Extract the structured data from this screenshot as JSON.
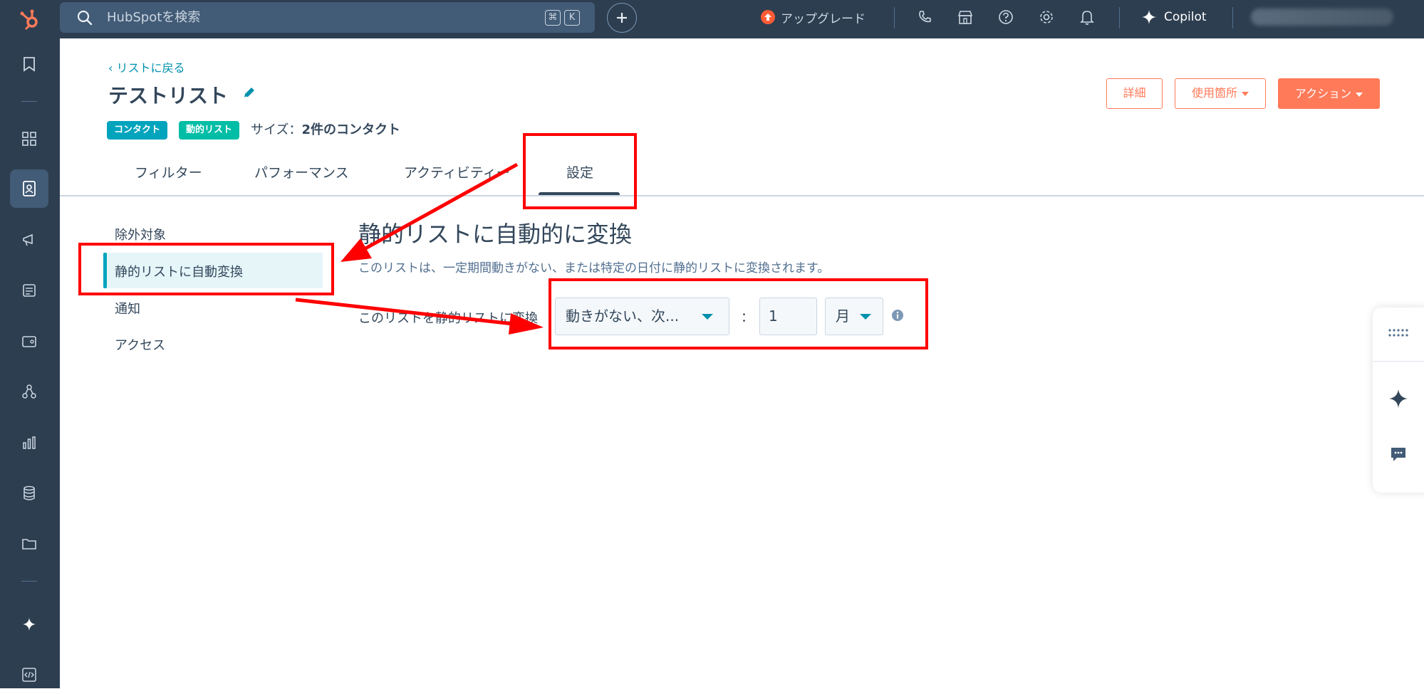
{
  "topbar": {
    "search_placeholder": "HubSpotを検索",
    "shortcut_keys": [
      "⌘",
      "K"
    ],
    "upgrade_label": "アップグレード",
    "copilot_label": "Copilot",
    "icons": [
      "phone-icon",
      "marketplace-icon",
      "help-icon",
      "settings-icon",
      "notifications-icon"
    ]
  },
  "sidebar": {
    "icons": [
      "bookmark-icon",
      "dashboard-icon",
      "contacts-icon",
      "marketing-icon",
      "content-icon",
      "commerce-icon",
      "automation-icon",
      "reporting-icon",
      "data-icon",
      "library-icon",
      "ai-icon",
      "developer-icon"
    ],
    "active": "contacts-icon"
  },
  "header": {
    "back_link": "リストに戻る",
    "title": "テストリスト",
    "badge_contact": "コンタクト",
    "badge_dynamic": "動的リスト",
    "size_prefix": "サイズ：",
    "size_value": "2件のコンタクト",
    "btn_details": "詳細",
    "btn_usage": "使用箇所",
    "btn_actions": "アクション"
  },
  "tabs": [
    {
      "label": "フィルター"
    },
    {
      "label": "パフォーマンス"
    },
    {
      "label": "アクティビティー"
    },
    {
      "label": "設定",
      "active": true
    }
  ],
  "subnav": [
    {
      "label": "除外対象"
    },
    {
      "label": "静的リストに自動変換",
      "active": true
    },
    {
      "label": "通知"
    },
    {
      "label": "アクセス"
    }
  ],
  "settings": {
    "section_title": "静的リストに自動的に変換",
    "description": "このリストは、一定期間動きがない、または特定の日付に静的リストに変換されます。",
    "row_label": "このリストを静的リストに変換",
    "condition_select": "動きがない、次...",
    "colon": "：",
    "period_value": "1",
    "unit_select": "月"
  },
  "colors": {
    "nav_bg": "#2d3e50",
    "accent_orange": "#ff7a59",
    "badge_contact": "#00a4bd",
    "badge_dynamic": "#00bda5",
    "annotation_red": "#ff0000"
  }
}
